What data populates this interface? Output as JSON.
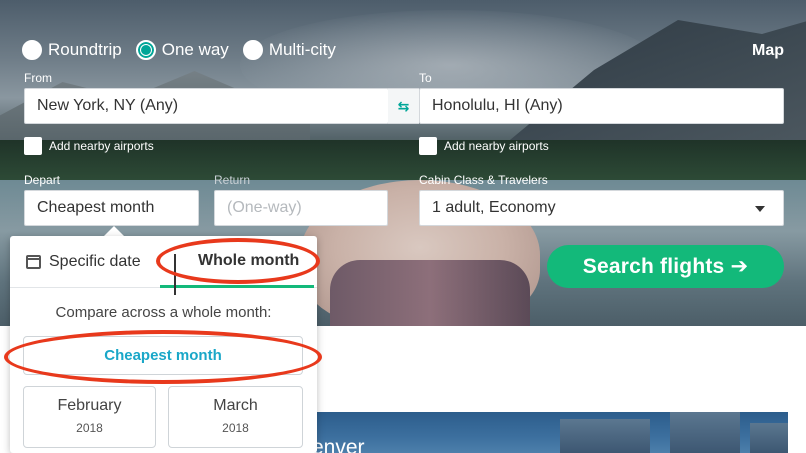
{
  "trip_type": {
    "options": [
      "Roundtrip",
      "One way",
      "Multi-city"
    ],
    "selected": "One way"
  },
  "map_link": "Map",
  "from": {
    "label": "From",
    "value": "New York, NY (Any)"
  },
  "to": {
    "label": "To",
    "value": "Honolulu, HI (Any)"
  },
  "nearby_from": "Add nearby airports",
  "nearby_to": "Add nearby airports",
  "depart": {
    "label": "Depart",
    "value": "Cheapest month"
  },
  "return": {
    "label": "Return",
    "placeholder": "(One-way)"
  },
  "cabin": {
    "label": "Cabin Class & Travelers",
    "value": "1 adult, Economy"
  },
  "search_button": "Search flights ➔",
  "date_popup": {
    "tabs": [
      {
        "label": "Specific date",
        "icon": "calendar-icon"
      },
      {
        "label": "Whole month",
        "icon": "bar-chart-icon",
        "active": true
      }
    ],
    "compare_text": "Compare across a whole month:",
    "cheapest_button": "Cheapest month",
    "months": [
      {
        "name": "February",
        "year": "2018"
      },
      {
        "name": "March",
        "year": "2018"
      }
    ]
  },
  "background_card_text": "enver",
  "colors": {
    "accent": "#00a698",
    "search_button": "#13b97a",
    "cheapest_text": "#1aa7c8",
    "annotation": "#e8391c"
  }
}
